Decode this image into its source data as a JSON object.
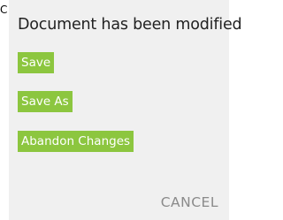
{
  "backdrop": {
    "edge_char": "C"
  },
  "dialog": {
    "title": "Document has been modified",
    "actions": {
      "save_label": "Save",
      "save_as_label": "Save As",
      "abandon_label": "Abandon Changes"
    },
    "cancel_label": "CANCEL"
  },
  "colors": {
    "action_button_bg": "#8cc63f",
    "dialog_bg": "#f0f0f0",
    "cancel_text": "#8a8a8a"
  }
}
